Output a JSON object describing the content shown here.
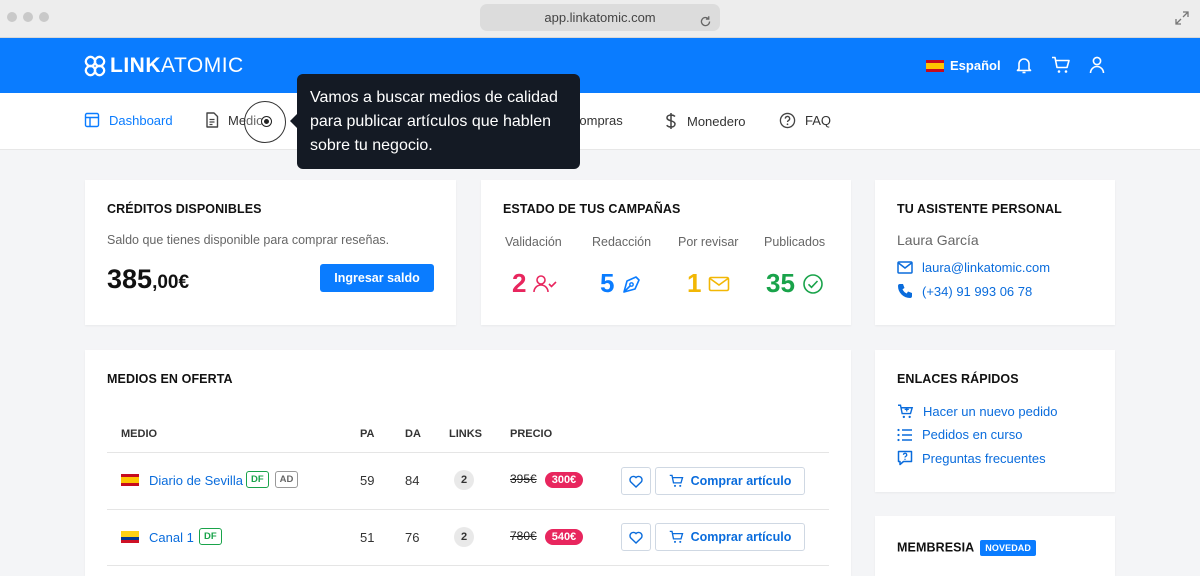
{
  "browser": {
    "url": "app.linkatomic.com"
  },
  "header": {
    "logo": {
      "bold": "LINK",
      "light": "ATOMIC"
    },
    "language": "Español"
  },
  "nav": {
    "items": [
      {
        "label": "Dashboard",
        "icon": "layout-icon",
        "active": true
      },
      {
        "label": "Medios",
        "icon": "document-icon"
      },
      {
        "label": "Compras",
        "icon": "cart-icon"
      },
      {
        "label": "Monedero",
        "icon": "dollar-icon"
      },
      {
        "label": "FAQ",
        "icon": "help-circle-icon"
      }
    ]
  },
  "tooltip": {
    "text": "Vamos a buscar medios de calidad para publicar artículos que hablen sobre tu negocio."
  },
  "credits": {
    "title": "CRÉDITOS DISPONIBLES",
    "subtitle": "Saldo que tienes disponible para comprar reseñas.",
    "amount_int": "385",
    "amount_dec": ",00€",
    "button": "Ingresar saldo"
  },
  "campaigns": {
    "title": "ESTADO DE TUS CAMPAÑAS",
    "stats": [
      {
        "label": "Validación",
        "value": "2",
        "color": "#e8265e"
      },
      {
        "label": "Redacción",
        "value": "5",
        "color": "#0a7cff"
      },
      {
        "label": "Por revisar",
        "value": "1",
        "color": "#f2b705"
      },
      {
        "label": "Publicados",
        "value": "35",
        "color": "#19a34a"
      }
    ]
  },
  "assistant": {
    "title": "TU ASISTENTE PERSONAL",
    "name": "Laura García",
    "email": "laura@linkatomic.com",
    "phone": "(+34) 91 993 06 78"
  },
  "offers": {
    "title": "MEDIOS EN OFERTA",
    "columns": [
      "MEDIO",
      "PA",
      "DA",
      "LINKS",
      "PRECIO"
    ],
    "buy_label": "Comprar artículo",
    "rows": [
      {
        "name": "Diario de Sevilla",
        "tags": [
          "DF",
          "AD"
        ],
        "pa": "59",
        "da": "84",
        "links": "2",
        "old_price": "395€",
        "price": "300€"
      },
      {
        "name": "Canal 1",
        "tags": [
          "DF"
        ],
        "pa": "51",
        "da": "76",
        "links": "2",
        "old_price": "780€",
        "price": "540€"
      }
    ]
  },
  "quick_links": {
    "title": "ENLACES RÁPIDOS",
    "items": [
      "Hacer un nuevo pedido",
      "Pedidos en curso",
      "Preguntas frecuentes"
    ]
  },
  "membership": {
    "title": "MEMBRESIA",
    "badge": "NOVEDAD"
  }
}
